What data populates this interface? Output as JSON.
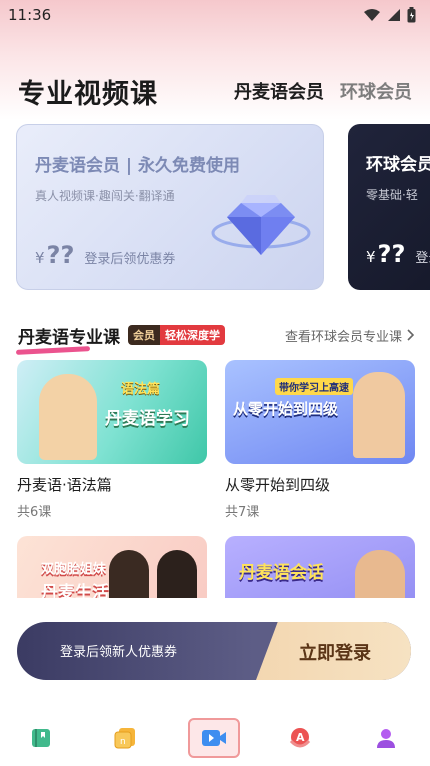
{
  "status_bar": {
    "time": "11:36"
  },
  "header": {
    "title": "专业视频课",
    "tabs": [
      {
        "label": "丹麦语会员",
        "active": true
      },
      {
        "label": "环球会员",
        "active": false
      }
    ]
  },
  "banners": [
    {
      "title": "丹麦语会员 | 永久免费使用",
      "subtitle": "真人视频课·趣闯关·翻译通",
      "price_symbol": "¥",
      "price": "??",
      "note": "登录后领优惠券"
    },
    {
      "title": "环球会员",
      "subtitle": "零基础·轻",
      "price_symbol": "¥",
      "price": "??",
      "note": "登录"
    }
  ],
  "section": {
    "title": "丹麦语专业课",
    "badge_member": "会员",
    "badge_tag": "轻松深度学",
    "see_more": "查看环球会员专业课"
  },
  "courses": [
    {
      "name": "丹麦语·语法篇",
      "count": "共6课",
      "thumb_title": "丹麦语学习",
      "thumb_sub": "语法篇"
    },
    {
      "name": "从零开始到四级",
      "count": "共7课",
      "thumb_title": "从零开始到四级",
      "thumb_sub": "带你学习上高速"
    },
    {
      "name": "",
      "count": "",
      "thumb_title": "丹麦生活",
      "thumb_sub": "双胞胎姐妹"
    },
    {
      "name": "",
      "count": "",
      "thumb_title": "丹麦语会话",
      "thumb_sub": ""
    }
  ],
  "login": {
    "hint": "登录后领新人优惠券",
    "button": "立即登录"
  },
  "colors": {
    "accent": "#e8357a",
    "login_dark": "#3b3b63",
    "login_gold": "#f3d7b1"
  },
  "bottom_nav": [
    {
      "icon": "book-icon",
      "active": false
    },
    {
      "icon": "cards-icon",
      "active": false
    },
    {
      "icon": "video-icon",
      "active": true
    },
    {
      "icon": "letter-a-icon",
      "active": false
    },
    {
      "icon": "profile-icon",
      "active": false
    }
  ]
}
